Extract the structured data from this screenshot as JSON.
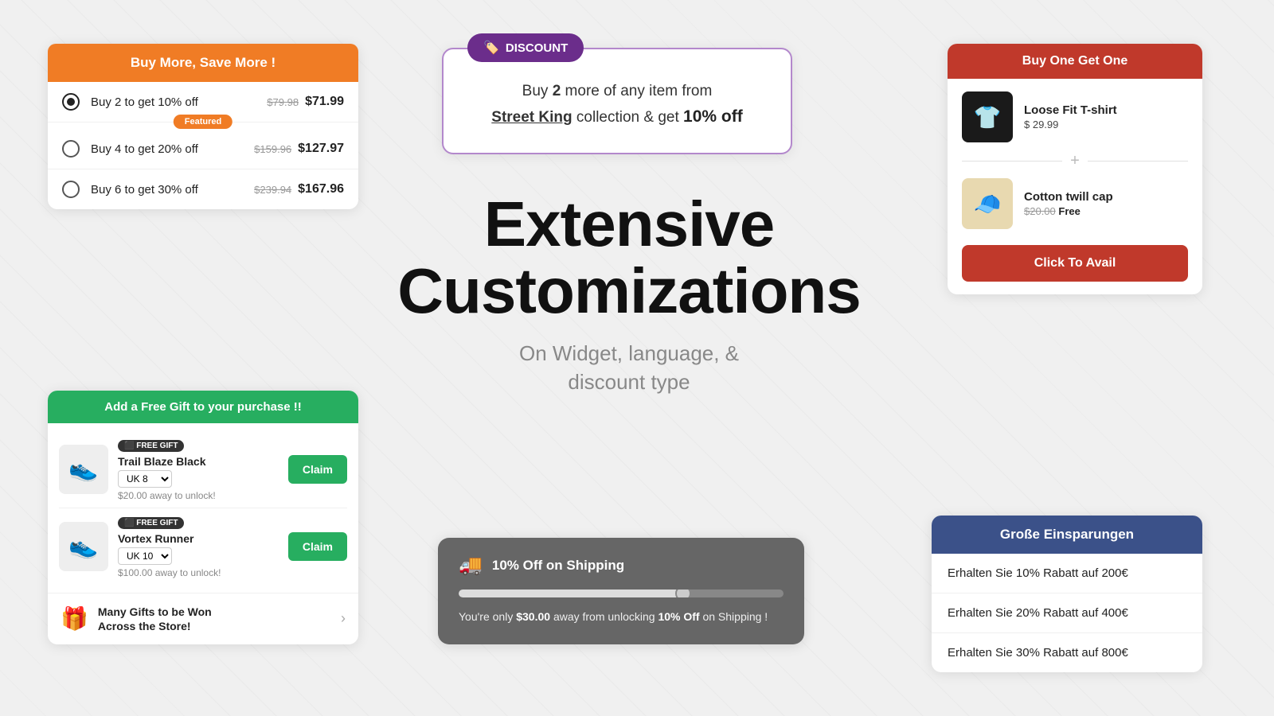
{
  "buyMore": {
    "header": "Buy More, Save More !",
    "tiers": [
      {
        "label": "Buy 2 to get 10% off",
        "origPrice": "$79.98",
        "discPrice": "$71.99",
        "selected": true,
        "featured": false
      },
      {
        "label": "Buy 4 to get 20% off",
        "origPrice": "$159.96",
        "discPrice": "$127.97",
        "selected": false,
        "featured": true
      },
      {
        "label": "Buy 6 to get 30% off",
        "origPrice": "$239.94",
        "discPrice": "$167.96",
        "selected": false,
        "featured": false
      }
    ],
    "featuredLabel": "Featured"
  },
  "discount": {
    "badgeLabel": "DISCOUNT",
    "text1": "Buy",
    "text2": "2",
    "text3": "more of any item from",
    "brandName": "Street King",
    "text4": "collection & get",
    "highlight": "10% off"
  },
  "bogo": {
    "header": "Buy One Get One",
    "item1": {
      "name": "Loose Fit T-shirt",
      "price": "$ 29.99"
    },
    "item2": {
      "name": "Cotton twill cap",
      "origPrice": "$20.00",
      "freeLabel": "Free"
    },
    "ctaLabel": "Click To Avail"
  },
  "centerHeading": {
    "title": "Extensive Customizations",
    "subtitle": "On Widget, language, &\ndiscount type"
  },
  "freeGift": {
    "header": "Add a Free Gift to your purchase !!",
    "items": [
      {
        "name": "Trail Blaze Black",
        "badge": "FREE GIFT",
        "size": "UK 8",
        "unlock": "$20.00 away to unlock!",
        "claimLabel": "Claim",
        "emoji": "👟"
      },
      {
        "name": "Vortex Runner",
        "badge": "FREE GIFT",
        "size": "UK 10",
        "unlock": "$100.00 away to unlock!",
        "claimLabel": "Claim",
        "emoji": "👟"
      }
    ],
    "manyGiftsText": "Many Gifts to be Won\nAcross the Store!"
  },
  "shipping": {
    "title": "10% Off on Shipping",
    "progress": 70,
    "description": "You're only",
    "amount": "$30.00",
    "desc2": "away from unlocking",
    "highlight": "10% Off",
    "desc3": "on Shipping !"
  },
  "german": {
    "header": "Große Einsparungen",
    "tiers": [
      "Erhalten Sie 10% Rabatt auf 200€",
      "Erhalten Sie 20% Rabatt auf 400€",
      "Erhalten Sie 30% Rabatt auf 800€"
    ]
  }
}
